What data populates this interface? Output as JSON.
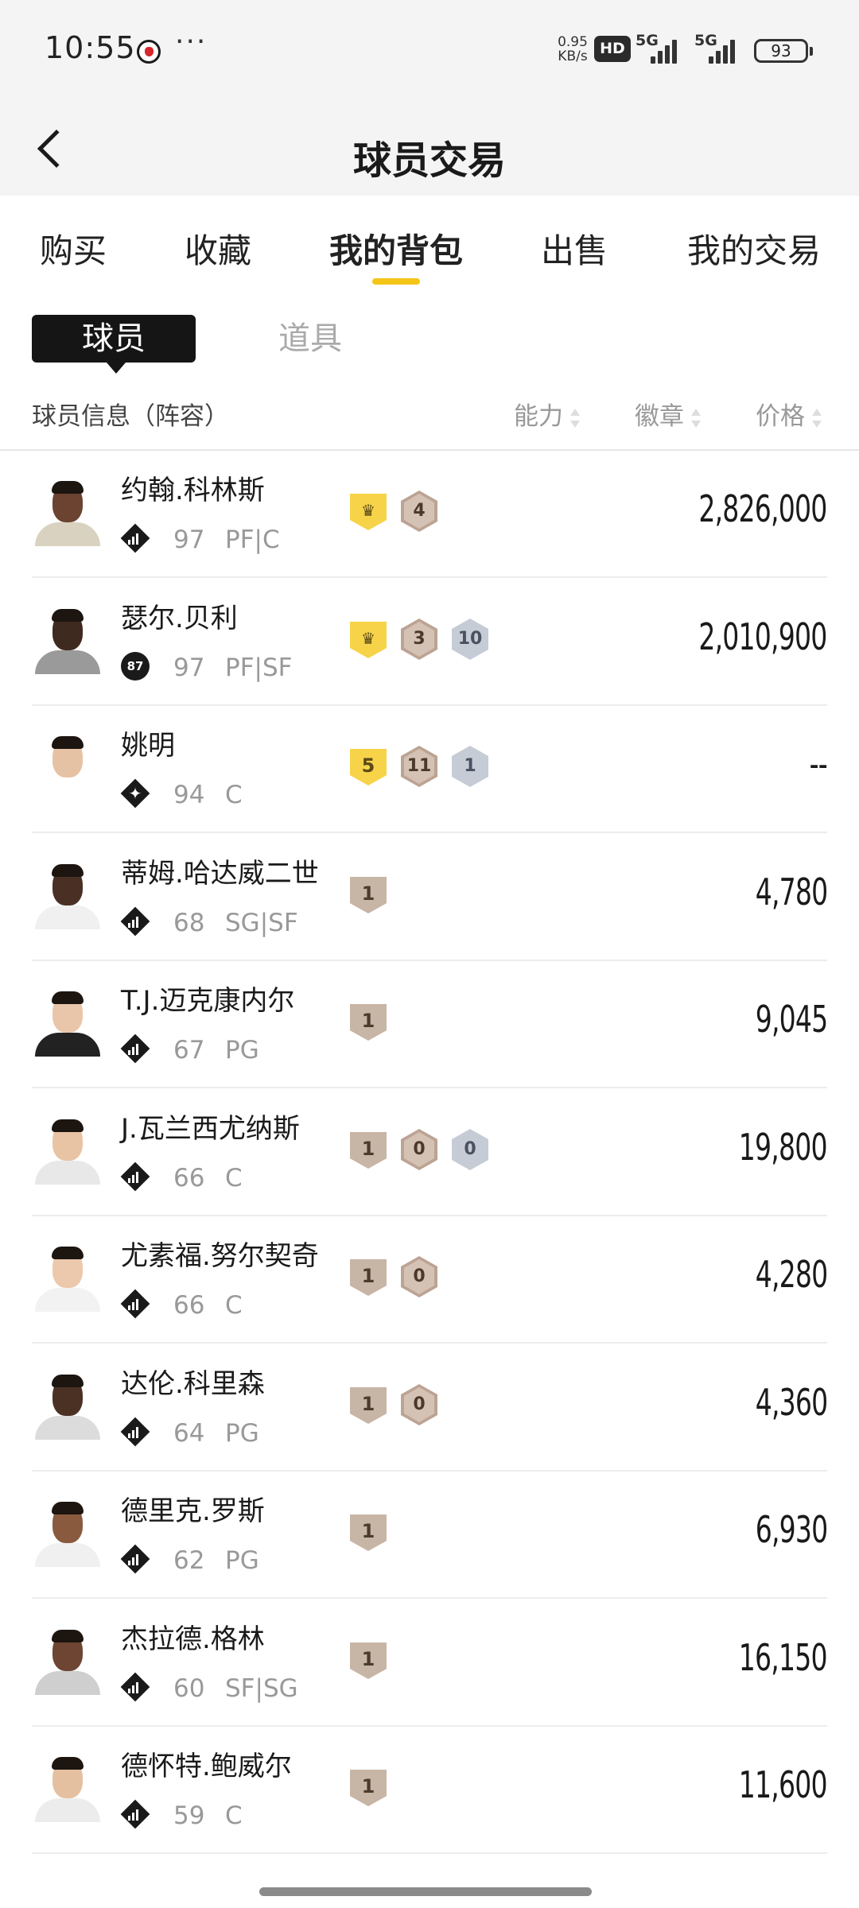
{
  "status_bar": {
    "time": "10:55",
    "app_icon": "rooster-logo-icon",
    "more_dots": "···",
    "net_speed_value": "0.95",
    "net_speed_unit": "KB/s",
    "hd_label": "HD",
    "net_type_1": "5G",
    "net_type_2": "5G",
    "battery": "93"
  },
  "header": {
    "title": "球员交易",
    "back_icon": "chevron-left-icon"
  },
  "tabs": [
    {
      "label": "购买",
      "active": false
    },
    {
      "label": "收藏",
      "active": false
    },
    {
      "label": "我的背包",
      "active": true
    },
    {
      "label": "出售",
      "active": false
    },
    {
      "label": "我的交易",
      "active": false
    }
  ],
  "accent_color": "#f5c518",
  "sub_tabs": {
    "players": "球员",
    "items": "道具"
  },
  "list_header": {
    "info": "球员信息（阵容）",
    "ability": "能力",
    "badges": "徽章",
    "price": "价格"
  },
  "players": [
    {
      "name": "约翰.科林斯",
      "ability": "97",
      "position": "PF|C",
      "rank_icon": "tier-bars-icon",
      "badges": [
        {
          "type": "crown",
          "value": ""
        },
        {
          "type": "bronze-hex",
          "value": "4"
        }
      ],
      "price": "2,826,000"
    },
    {
      "name": "瑟尔.贝利",
      "ability": "97",
      "position": "PF|SF",
      "rank_icon": "badge-87-icon",
      "rank_label": "87",
      "badges": [
        {
          "type": "crown",
          "value": ""
        },
        {
          "type": "bronze-hex",
          "value": "3"
        },
        {
          "type": "silver-hex",
          "value": "10"
        }
      ],
      "price": "2,010,900"
    },
    {
      "name": "姚明",
      "ability": "94",
      "position": "C",
      "rank_icon": "star-diamond-icon",
      "badges": [
        {
          "type": "gold-num",
          "value": "5"
        },
        {
          "type": "bronze-hex",
          "value": "11"
        },
        {
          "type": "silver-hex",
          "value": "1"
        }
      ],
      "price": "--"
    },
    {
      "name": "蒂姆.哈达威二世",
      "ability": "68",
      "position": "SG|SF",
      "rank_icon": "tier-bars-icon",
      "badges": [
        {
          "type": "tan-shield",
          "value": "1"
        }
      ],
      "price": "4,780"
    },
    {
      "name": "T.J.迈克康内尔",
      "ability": "67",
      "position": "PG",
      "rank_icon": "tier-bars-icon",
      "badges": [
        {
          "type": "tan-shield",
          "value": "1"
        }
      ],
      "price": "9,045"
    },
    {
      "name": "J.瓦兰西尤纳斯",
      "ability": "66",
      "position": "C",
      "rank_icon": "tier-bars-icon",
      "badges": [
        {
          "type": "tan-shield",
          "value": "1"
        },
        {
          "type": "bronze-hex",
          "value": "0"
        },
        {
          "type": "silver-hex",
          "value": "0"
        }
      ],
      "price": "19,800"
    },
    {
      "name": "尤素福.努尔契奇",
      "ability": "66",
      "position": "C",
      "rank_icon": "tier-bars-icon",
      "badges": [
        {
          "type": "tan-shield",
          "value": "1"
        },
        {
          "type": "bronze-hex",
          "value": "0"
        }
      ],
      "price": "4,280"
    },
    {
      "name": "达伦.科里森",
      "ability": "64",
      "position": "PG",
      "rank_icon": "tier-bars-icon",
      "badges": [
        {
          "type": "tan-shield",
          "value": "1"
        },
        {
          "type": "bronze-hex",
          "value": "0"
        }
      ],
      "price": "4,360"
    },
    {
      "name": "德里克.罗斯",
      "ability": "62",
      "position": "PG",
      "rank_icon": "tier-bars-icon",
      "badges": [
        {
          "type": "tan-shield",
          "value": "1"
        }
      ],
      "price": "6,930"
    },
    {
      "name": "杰拉德.格林",
      "ability": "60",
      "position": "SF|SG",
      "rank_icon": "tier-bars-icon",
      "badges": [
        {
          "type": "tan-shield",
          "value": "1"
        }
      ],
      "price": "16,150"
    },
    {
      "name": "德怀特.鲍威尔",
      "ability": "59",
      "position": "C",
      "rank_icon": "tier-bars-icon",
      "badges": [
        {
          "type": "tan-shield",
          "value": "1"
        }
      ],
      "price": "11,600"
    }
  ]
}
